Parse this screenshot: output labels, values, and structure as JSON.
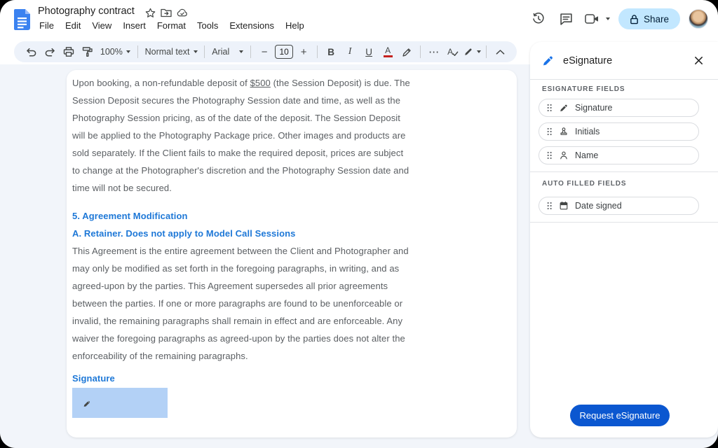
{
  "titlebar": {
    "doc_title": "Photography contract",
    "menus": [
      "File",
      "Edit",
      "View",
      "Insert",
      "Format",
      "Tools",
      "Extensions",
      "Help"
    ],
    "share_label": "Share"
  },
  "toolbar": {
    "zoom_value": "100%",
    "style_value": "Normal text",
    "font_value": "Arial",
    "font_size": "10",
    "bold_glyph": "B",
    "italic_glyph": "I",
    "underline_glyph": "U",
    "text_color_glyph": "A",
    "spellcheck_glyph": "A",
    "more_glyph": "⋯"
  },
  "document": {
    "paragraph1_pre": "Upon booking, a non-refundable deposit of ",
    "paragraph1_underlined": "$500",
    "paragraph1_post": " (the Session Deposit) is due. The Session Deposit secures the Photography Session date and time, as well as the Photography Session pricing, as of the date of the deposit. The Session Deposit will be applied to the Photography Package price. Other images and products are sold separately. If the Client fails to make the required deposit, prices are subject to change at the Photographer's discretion and the Photography Session date and time will not be secured.",
    "heading1": "5. Agreement Modification",
    "heading2": "A. Retainer.  Does not apply to Model Call Sessions",
    "paragraph2": "This Agreement is the entire agreement between the Client and Photographer and may only be modified as set forth in the foregoing paragraphs, in writing, and as agreed-upon by the parties.  This Agreement supersedes all prior agreements between the parties. If one or more paragraphs are found to be unenforceable or invalid, the remaining paragraphs shall remain in effect and are enforceable. Any waiver the foregoing paragraphs as agreed-upon by the parties does not alter the enforceability of the remaining paragraphs.",
    "signature_heading": "Signature"
  },
  "panel": {
    "title": "eSignature",
    "esignature_fields_label": "ESIGNATURE FIELDS",
    "fields": [
      {
        "label": "Signature",
        "icon": "signature-pen-icon"
      },
      {
        "label": "Initials",
        "icon": "initials-stamp-icon"
      },
      {
        "label": "Name",
        "icon": "person-icon"
      }
    ],
    "autofilled_label": "AUTO FILLED FIELDS",
    "autofilled_fields": [
      {
        "label": "Date signed",
        "icon": "calendar-icon"
      }
    ],
    "request_button_label": "Request eSignature"
  },
  "colors": {
    "accent_blue": "#1a73e8",
    "request_button_blue": "#0b57d0",
    "share_pill_blue": "#c2e7ff",
    "toolbar_pill": "#edf2fa",
    "doc_heading_blue": "#1e78d7",
    "signature_box_blue": "#b3d1f6",
    "body_text_grey": "#5a5e62"
  }
}
